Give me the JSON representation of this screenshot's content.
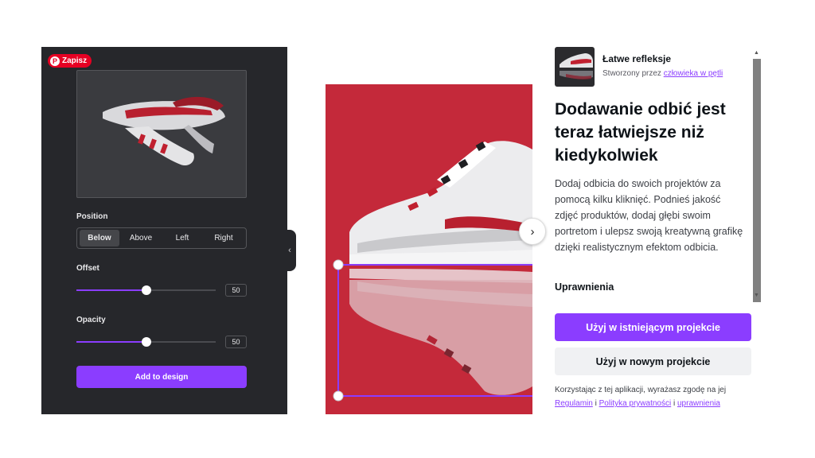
{
  "editor": {
    "save_label": "Zapisz",
    "position_label": "Position",
    "position_options": [
      "Below",
      "Above",
      "Left",
      "Right"
    ],
    "position_selected": "Below",
    "offset_label": "Offset",
    "offset_value": "50",
    "offset_fraction": 0.5,
    "opacity_label": "Opacity",
    "opacity_value": "50",
    "opacity_fraction": 0.5,
    "add_button": "Add to design"
  },
  "app": {
    "name": "Łatwe refleksje",
    "creator_prefix": "Stworzony przez ",
    "creator_link": "człowieka w pętli",
    "headline": "Dodawanie odbić jest teraz łatwiejsze niż kiedykolwiek",
    "description": "Dodaj odbicia do swoich projektów za pomocą kilku kliknięć. Podnieś jakość zdjęć produktów, dodaj głębi swoim portretom i ulepsz swoją kreatywną grafikę dzięki realistycznym efektom odbicia.",
    "permissions_label": "Uprawnienia",
    "use_existing": "Użyj w istniejącym projekcie",
    "use_new": "Użyj w nowym projekcie",
    "consent_text": "Korzystając z tej aplikacji, wyrażasz zgodę na jej",
    "consent_links": [
      "Regulamin",
      "Polityka prywatności",
      "uprawnienia"
    ],
    "consent_sep": "i"
  },
  "colors": {
    "accent": "#8b3dff",
    "panel_dark": "#26272b",
    "image_red": "#c4293a",
    "pinterest_red": "#e60023"
  },
  "icons": {
    "save": "pinterest-icon",
    "collapse": "chevron-left-icon",
    "next": "chevron-right-icon",
    "scroll_up": "scroll-up-icon",
    "scroll_down": "scroll-down-icon"
  }
}
